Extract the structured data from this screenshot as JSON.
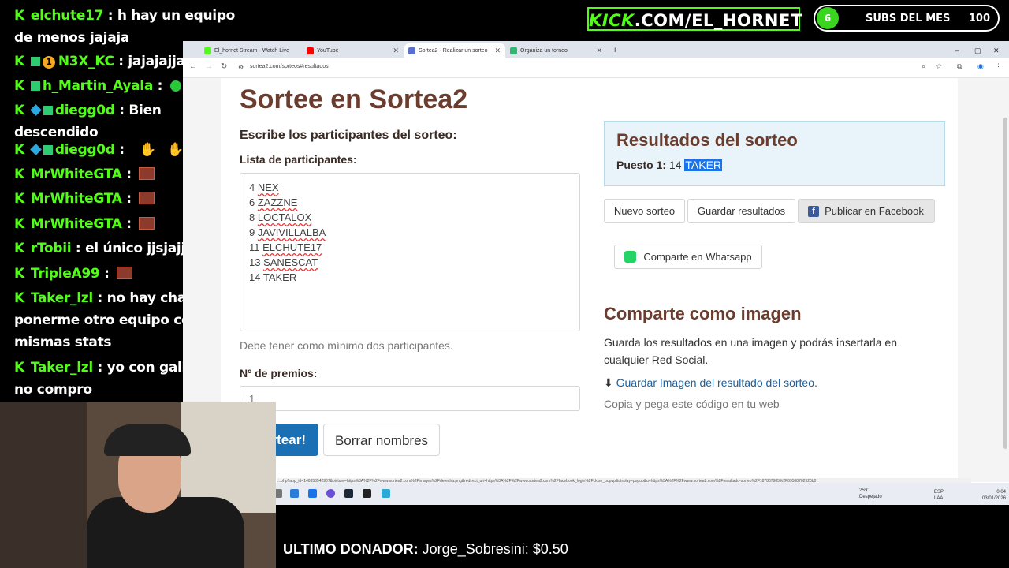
{
  "chat": [
    {
      "user": "elchute17",
      "message": "h hay un equipo de menos jajaja",
      "badges": [
        "kick"
      ]
    },
    {
      "user": "N3X_KC",
      "message": "jajajajjaa",
      "badges": [
        "kick",
        "green",
        "one"
      ]
    },
    {
      "user": "h_Martin_Ayala",
      "message": "",
      "badges": [
        "kick",
        "green"
      ],
      "emote": "green-emote"
    },
    {
      "user": "diegg0d",
      "message": "Bien descendido",
      "badges": [
        "kick",
        "blue",
        "green"
      ]
    },
    {
      "user": "diegg0d",
      "message": "",
      "badges": [
        "kick",
        "blue",
        "green"
      ],
      "emote": "hand-emotes"
    },
    {
      "user": "MrWhiteGTA",
      "message": "",
      "badges": [
        "kick"
      ],
      "emote": "brick-emote"
    },
    {
      "user": "MrWhiteGTA",
      "message": "",
      "badges": [
        "kick"
      ],
      "emote": "brick-emote"
    },
    {
      "user": "MrWhiteGTA",
      "message": "",
      "badges": [
        "kick"
      ],
      "emote": "brick-emote"
    },
    {
      "user": "rTobii",
      "message": "el único jjsjajjjajaa",
      "badges": [
        "kick"
      ]
    },
    {
      "user": "TripleA99",
      "message": "",
      "badges": [
        "kick"
      ],
      "emote": "brick-emote"
    },
    {
      "user": "Taker_lzl",
      "message": "no hay chanxe de ponerme otro equipo con mismas stats",
      "badges": [
        "kick"
      ]
    },
    {
      "user": "Taker_lzl",
      "message": "yo con gallinas no compro",
      "badges": [
        "kick"
      ]
    }
  ],
  "overlay": {
    "kick_brand": "KICK",
    "kick_url": ".COM/EL_HORNET",
    "subs_count_current": "6",
    "subs_label": "SUBS DEL MES",
    "subs_goal": "100",
    "donor_label": "ULTIMO DONADOR:",
    "donor_value": "Jorge_Sobresini: $0.50"
  },
  "browser": {
    "tabs": [
      {
        "label": "El_hornet Stream - Watch Live",
        "icon_color": "#53fc18"
      },
      {
        "label": "YouTube",
        "icon_color": "#ff0000"
      },
      {
        "label": "Sortea2 - Realizar un sorteo",
        "icon_color": "#5b6fd1",
        "active": true
      },
      {
        "label": "Organiza un torneo",
        "icon_color": "#2eb872"
      }
    ],
    "url": "sortea2.com/sorteos#resultados",
    "status_url": "...php?app_id=140853542907&picture=https%3A%2F%2Fwww.sortea2.com%2Fimages%2Fderecha.png&redirect_uri=https%3A%2F%2Fwww.sortea2.com%2Ffacebook_login%2Fclose_popup&display=popup&u=https%3A%2F%2Fwww.sortea2.com%2Fresultado-sorteo%2F187807985%2F69588702920b0"
  },
  "page": {
    "title": "Sortee en Sortea2",
    "subtitle": "Escribe los participantes del sorteo:",
    "list_label": "Lista de participantes:",
    "participants": [
      {
        "num": "4",
        "name": "NEX",
        "squiggle": true
      },
      {
        "num": "6",
        "name": "ZAZZNE",
        "squiggle": true
      },
      {
        "num": "8",
        "name": "LOCTALOX",
        "squiggle": true
      },
      {
        "num": "9",
        "name": "JAVIVILLALBA",
        "squiggle": true
      },
      {
        "num": "11",
        "name": "ELCHUTE17",
        "squiggle": true
      },
      {
        "num": "13",
        "name": "SANESCAT",
        "squiggle": true
      },
      {
        "num": "14",
        "name": "TAKER",
        "squiggle": false
      }
    ],
    "min_message": "Debe tener como mínimo dos participantes.",
    "premios_label": "Nº de premios:",
    "premios_value": "1",
    "sortear_label": "¡Sortear!",
    "borrar_label": "Borrar nombres",
    "results_title": "Resultados del sorteo",
    "result_prefix": "Puesto 1:",
    "result_num": "14",
    "result_name": "TAKER",
    "nuevo_label": "Nuevo sorteo",
    "guardar_label": "Guardar resultados",
    "facebook_label": "Publicar en Facebook",
    "whatsapp_label": "Comparte en Whatsapp",
    "comparte_title": "Comparte como imagen",
    "comparte_text": "Guarda los resultados en una imagen y podrás insertarla en cualquier Red Social.",
    "guardar_imagen_label": "Guardar Imagen del resultado del sorteo.",
    "copia_label": "Copia y pega este código en tu web"
  },
  "taskbar": {
    "weather_temp": "25ºC",
    "weather_desc": "Despejado",
    "lang": "ESP",
    "lang_region": "LAA",
    "time": "0:04",
    "date": "03/01/2026"
  }
}
